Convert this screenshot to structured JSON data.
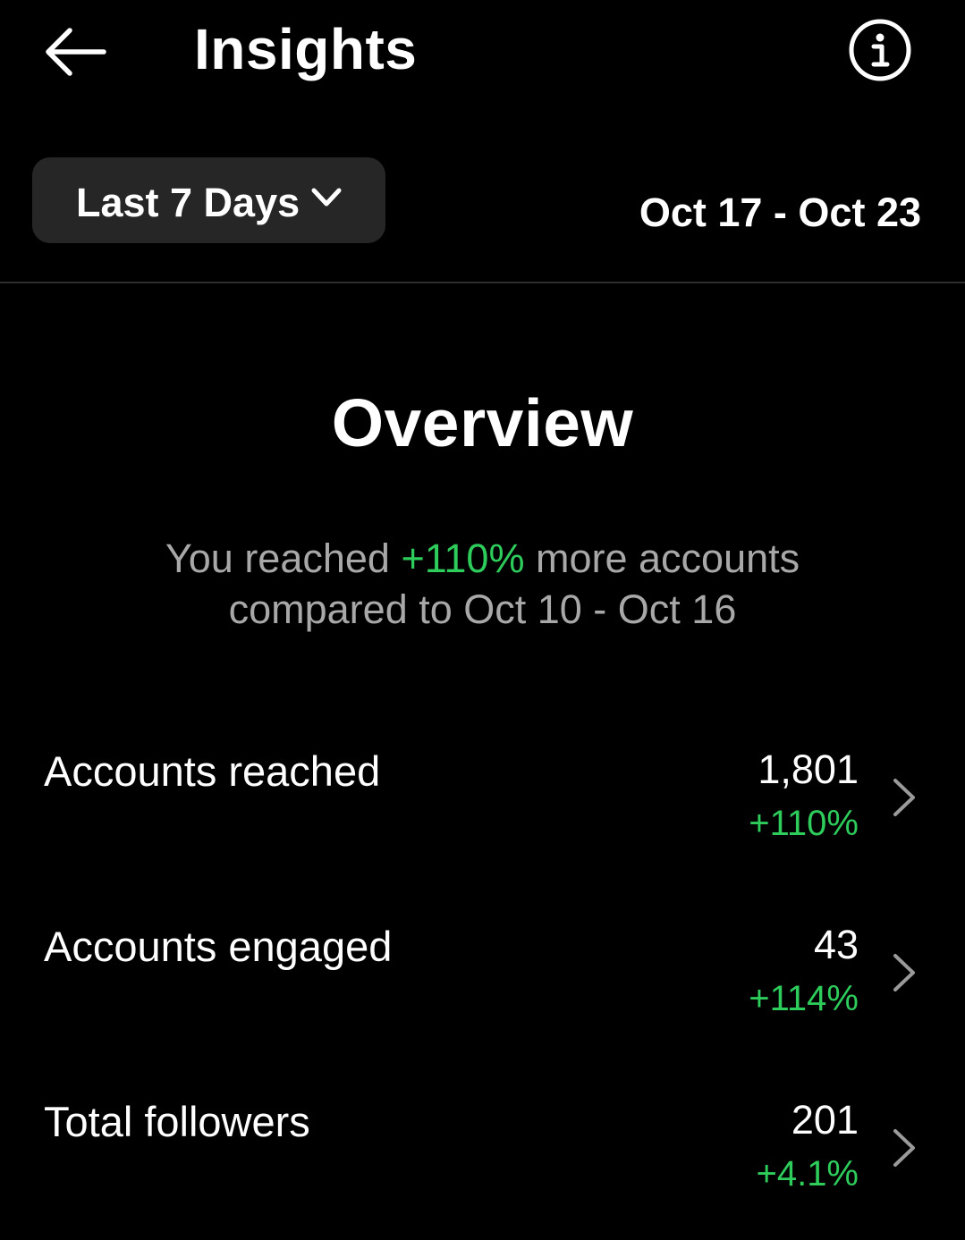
{
  "header": {
    "title": "Insights",
    "back_icon": "arrow-left-icon",
    "info_icon": "info-circle-icon"
  },
  "filter": {
    "period_label": "Last 7 Days",
    "date_range": "Oct 17 - Oct 23",
    "dropdown_icon": "chevron-down-icon"
  },
  "overview": {
    "title": "Overview",
    "summary_prefix": "You reached ",
    "summary_highlight": "+110%",
    "summary_suffix": " more accounts",
    "summary_line2": "compared to Oct 10 - Oct 16"
  },
  "metrics": [
    {
      "label": "Accounts reached",
      "value": "1,801",
      "change": "+110%"
    },
    {
      "label": "Accounts engaged",
      "value": "43",
      "change": "+114%"
    },
    {
      "label": "Total followers",
      "value": "201",
      "change": "+4.1%"
    }
  ],
  "colors": {
    "background": "#000000",
    "positive": "#2ecc5b",
    "muted_text": "#a8a8a8",
    "button_bg": "#262626"
  }
}
